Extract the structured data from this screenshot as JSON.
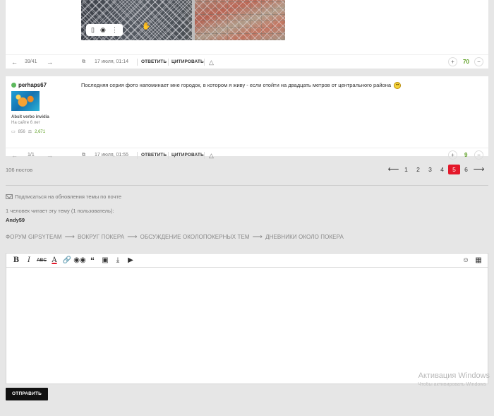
{
  "post1": {
    "nav_position": "39/41",
    "date": "17 июля, 01:14",
    "reply_label": "ОТВЕТИТЬ",
    "quote_label": "ЦИТИРОВАТЬ",
    "score": "70"
  },
  "post2": {
    "author": "perhaps67",
    "motto": "Absit verbo invidia",
    "member_since": "На сайте 6 лет",
    "posts_count": "856",
    "reputation": "2,671",
    "text": "Последняя серия фото напоминает мне городок, в котором я живу - если отойти на двадцать метров от центрального района",
    "nav_position": "1/1",
    "date": "17 июля, 01:55",
    "reply_label": "ОТВЕТИТЬ",
    "quote_label": "ЦИТИРОВАТЬ",
    "score": "9"
  },
  "thread": {
    "total_posts": "106 постов",
    "pages": [
      "1",
      "2",
      "3",
      "4",
      "5",
      "6"
    ],
    "current_page": "5",
    "subscribe_label": "Подписаться на обновления темы по почте",
    "readers_text": "1 человек читает эту тему (1 пользователь):",
    "reader_name": "Andy59"
  },
  "breadcrumb": [
    "ФОРУМ GIPSYTEAM",
    "ВОКРУГ ПОКЕРА",
    "ОБСУЖДЕНИЕ ОКОЛОПОКЕРНЫХ ТЕМ",
    "ДНЕВНИКИ ОКОЛО ПОКЕРА"
  ],
  "editor": {
    "toolbar_icons": [
      "bold-icon",
      "italic-icon",
      "strikethrough-icon",
      "text-color-icon",
      "link-icon",
      "spoiler-icon",
      "quote-icon",
      "image-icon",
      "upload-icon",
      "video-icon",
      "emoji-icon",
      "source-icon"
    ],
    "submit_label": "ОТПРАВИТЬ"
  },
  "watermark": {
    "line1": "Активация Windows",
    "line2": "Чтобы активировать Windows"
  },
  "colors": {
    "accent_red": "#e4182a",
    "positive_green": "#5a9e1f",
    "online_green": "#5cb85c"
  }
}
